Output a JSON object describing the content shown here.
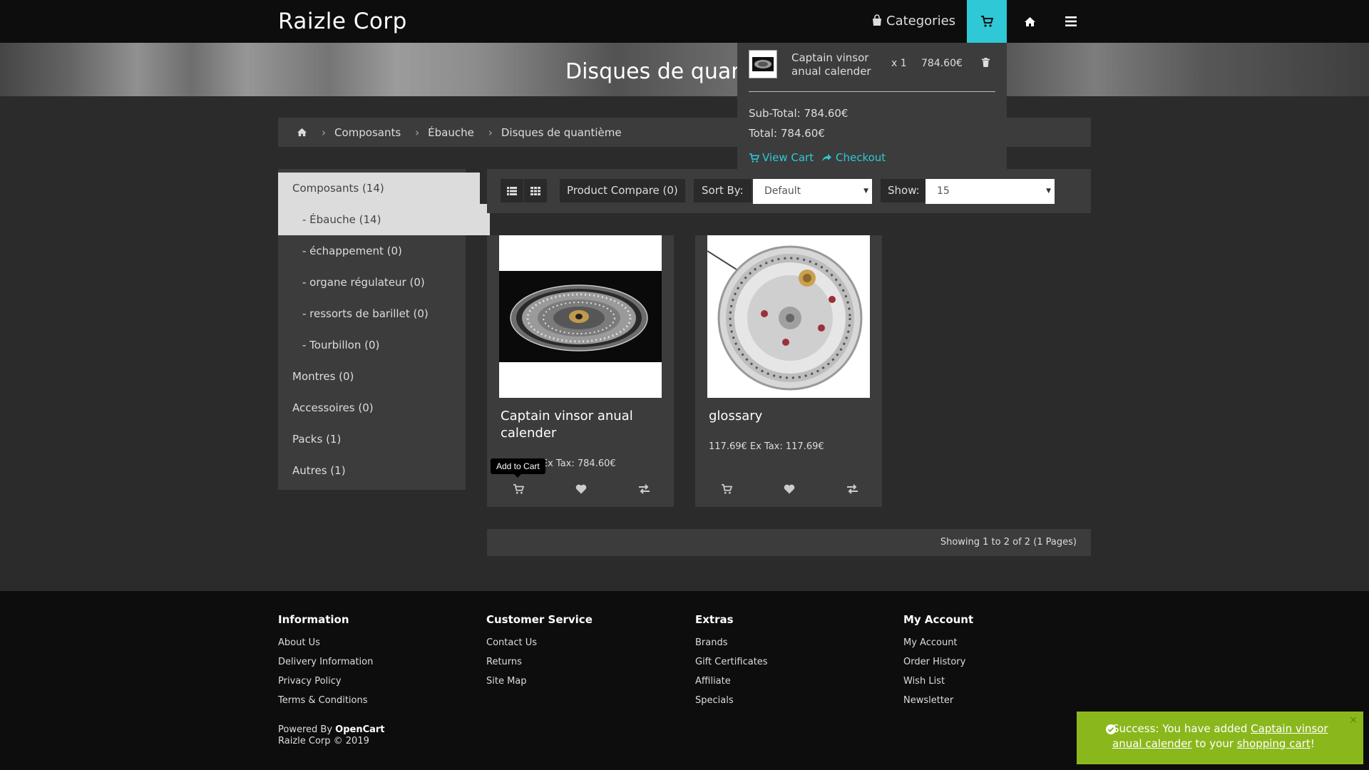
{
  "header": {
    "brand": "Raizle Corp",
    "categories_label": "Categories",
    "icons": [
      "shopping-bag-icon",
      "cart-icon",
      "home-icon",
      "menu-icon"
    ],
    "accent_color": "#2ec8d6"
  },
  "hero": {
    "title": "Disques de quantième"
  },
  "breadcrumb": {
    "items": [
      "Composants",
      "Ébauche",
      "Disques de quantième"
    ]
  },
  "sidebar": {
    "items": [
      {
        "label": "Composants (14)",
        "active": true
      },
      {
        "label": "- Ébauche (14)",
        "active": true
      },
      {
        "label": "- échappement (0)"
      },
      {
        "label": "- organe régulateur (0)"
      },
      {
        "label": "- ressorts de barillet (0)"
      },
      {
        "label": "- Tourbillon (0)"
      },
      {
        "label": "Montres (0)"
      },
      {
        "label": "Accessoires (0)"
      },
      {
        "label": "Packs (1)"
      },
      {
        "label": "Autres (1)"
      }
    ]
  },
  "toolbar": {
    "compare_label": "Product Compare (0)",
    "sort_label": "Sort By:",
    "sort_value": "Default",
    "show_label": "Show:",
    "show_value": "15"
  },
  "products": [
    {
      "name": "Captain vinsor anual calender",
      "price_line": "784.60€ Ex Tax: 784.60€"
    },
    {
      "name": "glossary",
      "price_line": "117.69€ Ex Tax: 117.69€"
    }
  ],
  "tooltip": "Add to Cart",
  "pagination": {
    "text": "Showing 1 to 2 of 2 (1 Pages)"
  },
  "cart_dropdown": {
    "item_name": "Captain vinsor anual calender",
    "item_qty": "x 1",
    "item_price": "784.60€",
    "subtotal": "Sub-Total: 784.60€",
    "total": "Total: 784.60€",
    "view_cart": "View Cart",
    "checkout": "Checkout"
  },
  "footer": {
    "columns": [
      {
        "title": "Information",
        "links": [
          "About Us",
          "Delivery Information",
          "Privacy Policy",
          "Terms & Conditions"
        ]
      },
      {
        "title": "Customer Service",
        "links": [
          "Contact Us",
          "Returns",
          "Site Map"
        ]
      },
      {
        "title": "Extras",
        "links": [
          "Brands",
          "Gift Certificates",
          "Affiliate",
          "Specials"
        ]
      },
      {
        "title": "My Account",
        "links": [
          "My Account",
          "Order History",
          "Wish List",
          "Newsletter"
        ]
      }
    ],
    "powered_prefix": "Powered By",
    "powered_brand": "OpenCart",
    "copyright": "Raizle Corp © 2019"
  },
  "alert": {
    "prefix": "Success: You have added",
    "product_link": "Captain vinsor anual calender",
    "middle": "to your",
    "cart_link": "shopping cart",
    "suffix": "!",
    "close": "×",
    "color": "#8ab81c"
  }
}
